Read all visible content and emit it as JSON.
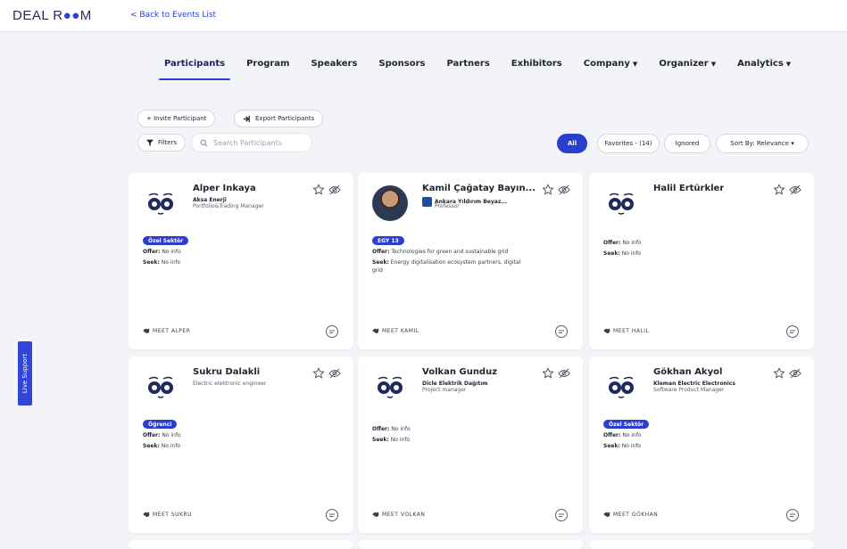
{
  "header": {
    "logo": {
      "part1": "DEAL R",
      "part2": "●●",
      "part3": "M"
    },
    "back_link": "< Back to Events List"
  },
  "live_support": "Live Support",
  "tabs": [
    {
      "label": "Participants",
      "active": true
    },
    {
      "label": "Program"
    },
    {
      "label": "Speakers"
    },
    {
      "label": "Sponsors"
    },
    {
      "label": "Partners"
    },
    {
      "label": "Exhibitors"
    },
    {
      "label": "Company",
      "dropdown": true
    },
    {
      "label": "Organizer",
      "dropdown": true
    },
    {
      "label": "Analytics",
      "dropdown": true
    }
  ],
  "toolbar": {
    "invite": "+ Invite Participant",
    "export": "Export Participants",
    "filters": "Filters",
    "search_placeholder": "Search Participants"
  },
  "filters": {
    "all": "All",
    "favorites": "Favorites - (14)",
    "ignored": "Ignored",
    "sort": "Sort By: Relevance ▾"
  },
  "colors": {
    "accent": "#2a3fd0",
    "avatar_face": "#1f2a5a"
  },
  "participants": [
    {
      "name": "Alper Inkaya",
      "company": "Aksa Enerji",
      "role": "Portfolio&Trading Manager",
      "badge": "Özel Sektör",
      "offer_label": "Offer:",
      "offer": "No info",
      "seek_label": "Seek:",
      "seek": "No info",
      "meet": "MEET ALPER"
    },
    {
      "name": "Kamil Çağatay Bayın...",
      "company": "Ankara Yıldırım Beyaz...",
      "role": "Professor",
      "badge": "EGY 13",
      "offer_label": "Offer:",
      "offer": "Technologies for green and sustainable grid",
      "seek_label": "Seek:",
      "seek": "Energy digitalisation ecosystem partners, digital",
      "seek2": "grid",
      "meet": "MEET KAMIL",
      "photo": true
    },
    {
      "name": "Halil Ertürkler",
      "company": "",
      "role": "",
      "badge": "",
      "offer_label": "Offer:",
      "offer": "No info",
      "seek_label": "Seek:",
      "seek": "No info",
      "meet": "MEET HALIL"
    },
    {
      "name": "Sukru Dalakli",
      "company": "",
      "role": "Electric elektronic engineer",
      "badge": "Öğrenci",
      "offer_label": "Offer:",
      "offer": "No info",
      "seek_label": "Seek:",
      "seek": "No info",
      "meet": "MEET SUKRU"
    },
    {
      "name": "Volkan Gunduz",
      "company": "Dicle Elektrik Dağıtım",
      "role": "Project manager",
      "badge": "",
      "offer_label": "Offer:",
      "offer": "No info",
      "seek_label": "Seek:",
      "seek": "No info",
      "meet": "MEET VOLKAN"
    },
    {
      "name": "Gökhan Akyol",
      "company": "Kleman Electric Electronics",
      "role": "Software Product Manager",
      "badge": "Özel Sektör",
      "offer_label": "Offer:",
      "offer": "No info",
      "seek_label": "Seek:",
      "seek": "No info",
      "meet": "MEET GÖKHAN"
    }
  ]
}
